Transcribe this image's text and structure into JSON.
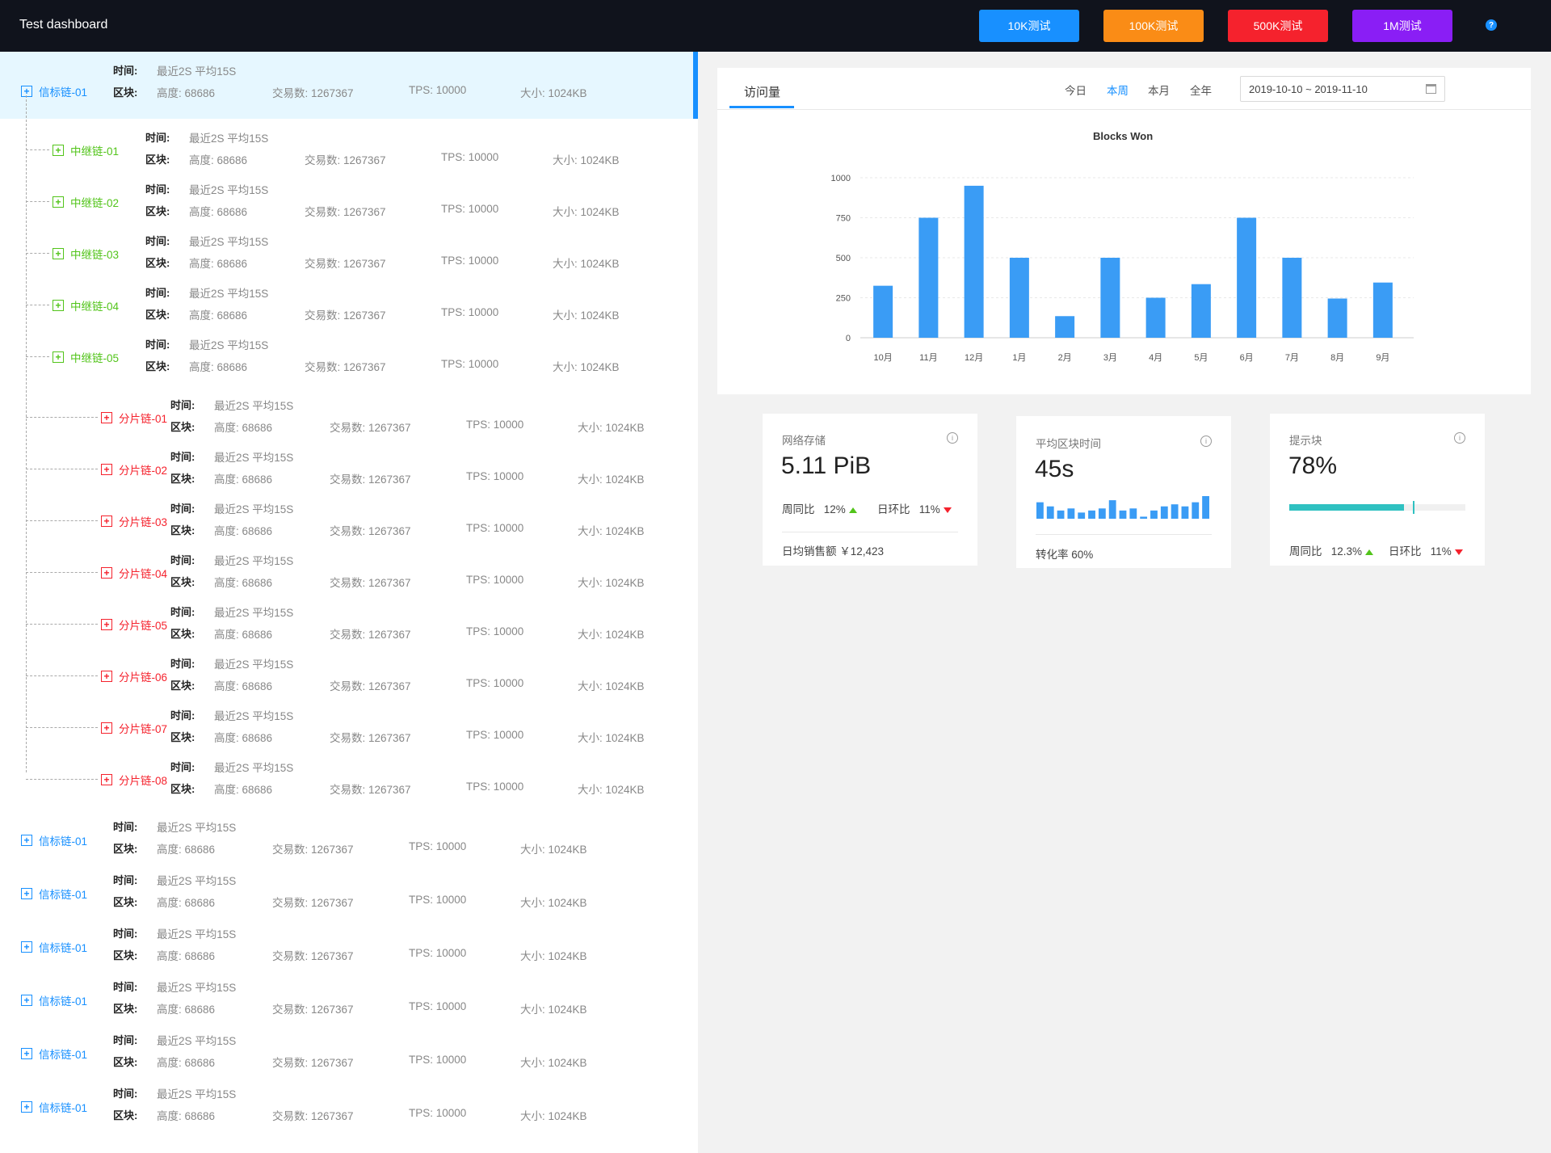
{
  "app": {
    "title": "Test dashboard",
    "buttons": [
      {
        "label": "10K测试",
        "color": "#1890ff"
      },
      {
        "label": "100K测试",
        "color": "#fa8c16"
      },
      {
        "label": "500K测试",
        "color": "#f5222d"
      },
      {
        "label": "1M测试",
        "color": "#8a1ef5"
      }
    ],
    "help_icon": "?"
  },
  "tree": {
    "time_label": "时间:",
    "block_label": "区块:",
    "time_value": "最近2S 平均15S",
    "height": "高度: 68686",
    "tx": "交易数: 1267367",
    "tps": "TPS: 10000",
    "size": "大小: 1024KB",
    "expander_symbol": "+",
    "beacon_color": "#1890ff",
    "relay_color": "#52c41a",
    "shard_color": "#f5222d",
    "beacon_top": {
      "label": "信标链-01"
    },
    "relays": [
      {
        "label": "中继链-01"
      },
      {
        "label": "中继链-02"
      },
      {
        "label": "中继链-03"
      },
      {
        "label": "中继链-04"
      },
      {
        "label": "中继链-05"
      }
    ],
    "shards": [
      {
        "label": "分片链-01"
      },
      {
        "label": "分片链-02"
      },
      {
        "label": "分片链-03"
      },
      {
        "label": "分片链-04"
      },
      {
        "label": "分片链-05"
      },
      {
        "label": "分片链-06"
      },
      {
        "label": "分片链-07"
      },
      {
        "label": "分片链-08"
      }
    ],
    "beacons": [
      {
        "label": "信标链-01"
      },
      {
        "label": "信标链-01"
      },
      {
        "label": "信标链-01"
      },
      {
        "label": "信标链-01"
      },
      {
        "label": "信标链-01"
      },
      {
        "label": "信标链-01"
      }
    ]
  },
  "visits": {
    "tab": "访问量",
    "periods": [
      "今日",
      "本周",
      "本月",
      "全年"
    ],
    "active_period": "本周",
    "date_range": "2019-10-10 ~ 2019-11-10"
  },
  "chart_data": {
    "type": "bar",
    "title": "Blocks Won",
    "categories": [
      "10月",
      "11月",
      "12月",
      "1月",
      "2月",
      "3月",
      "4月",
      "5月",
      "6月",
      "7月",
      "8月",
      "9月"
    ],
    "values": [
      325,
      750,
      950,
      500,
      135,
      500,
      250,
      335,
      750,
      500,
      245,
      345
    ],
    "ylim": [
      0,
      1000
    ],
    "yticks": [
      0,
      250,
      500,
      750,
      1000
    ],
    "bar_color": "#3a9cf5",
    "grid": true
  },
  "metrics": [
    {
      "title": "网络存储",
      "value": "5.11 PiB",
      "wow_label": "周同比",
      "wow_value": "12%",
      "dod_label": "日环比",
      "dod_value": "11%",
      "footer": "日均销售额 ￥12,423"
    },
    {
      "title": "平均区块时间",
      "value": "45s",
      "mini_bars": [
        8,
        6,
        4,
        5,
        3,
        4,
        5,
        9,
        4,
        5,
        1,
        4,
        6,
        7,
        6,
        8,
        11
      ],
      "footer": "转化率  60%"
    },
    {
      "title": "提示块",
      "value": "78%",
      "progress": 0.65,
      "target": 0.7,
      "progress_color": "#2fc1c1",
      "wow_label": "周同比",
      "wow_value": "12.3%",
      "dod_label": "日环比",
      "dod_value": "11%"
    }
  ]
}
